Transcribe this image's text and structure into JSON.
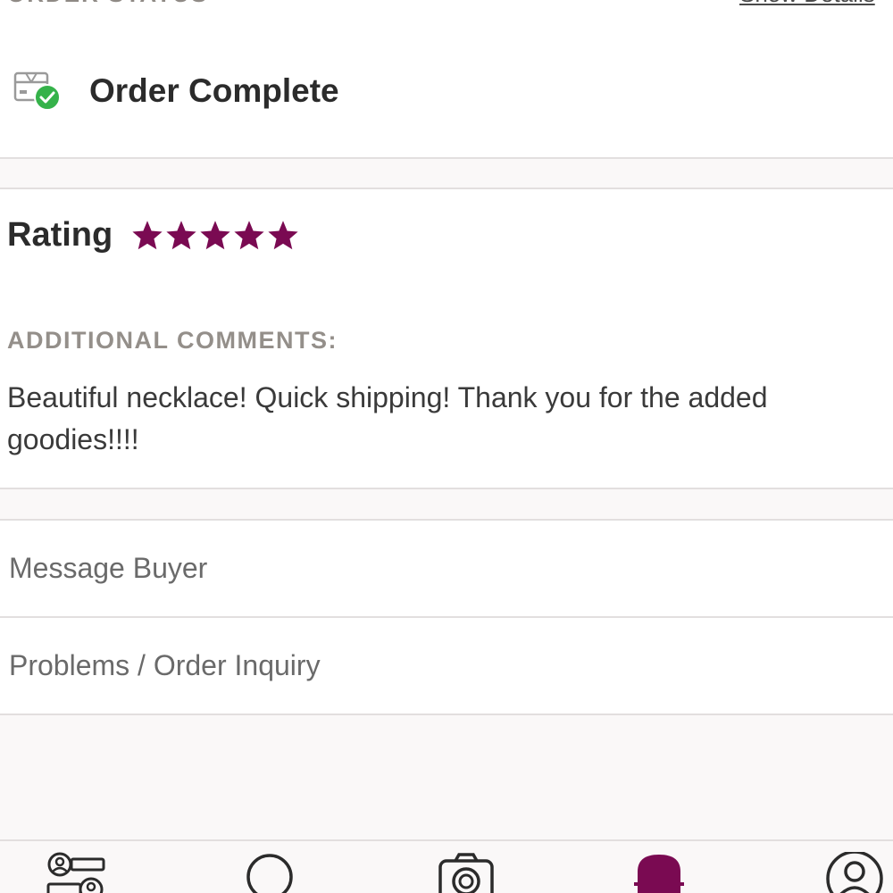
{
  "order_status": {
    "section_label": "ORDER STATUS",
    "show_details": "Show Details",
    "status_title": "Order Complete"
  },
  "rating": {
    "label": "Rating",
    "stars": 5,
    "max_stars": 5,
    "star_color": "#7a0a52"
  },
  "comments": {
    "label": "ADDITIONAL COMMENTS:",
    "text": "Beautiful necklace! Quick shipping! Thank you for the added goodies!!!!"
  },
  "actions": [
    {
      "label": "Message Buyer"
    },
    {
      "label": "Problems / Order Inquiry"
    }
  ],
  "bottom_nav": {
    "items": [
      {
        "icon": "feed-icon"
      },
      {
        "icon": "search-icon"
      },
      {
        "icon": "camera-icon"
      },
      {
        "icon": "closet-icon",
        "active": true
      },
      {
        "icon": "account-icon"
      }
    ],
    "active_color": "#7a0a52"
  },
  "colors": {
    "success_green": "#35b24a",
    "accent": "#7a0a52"
  }
}
